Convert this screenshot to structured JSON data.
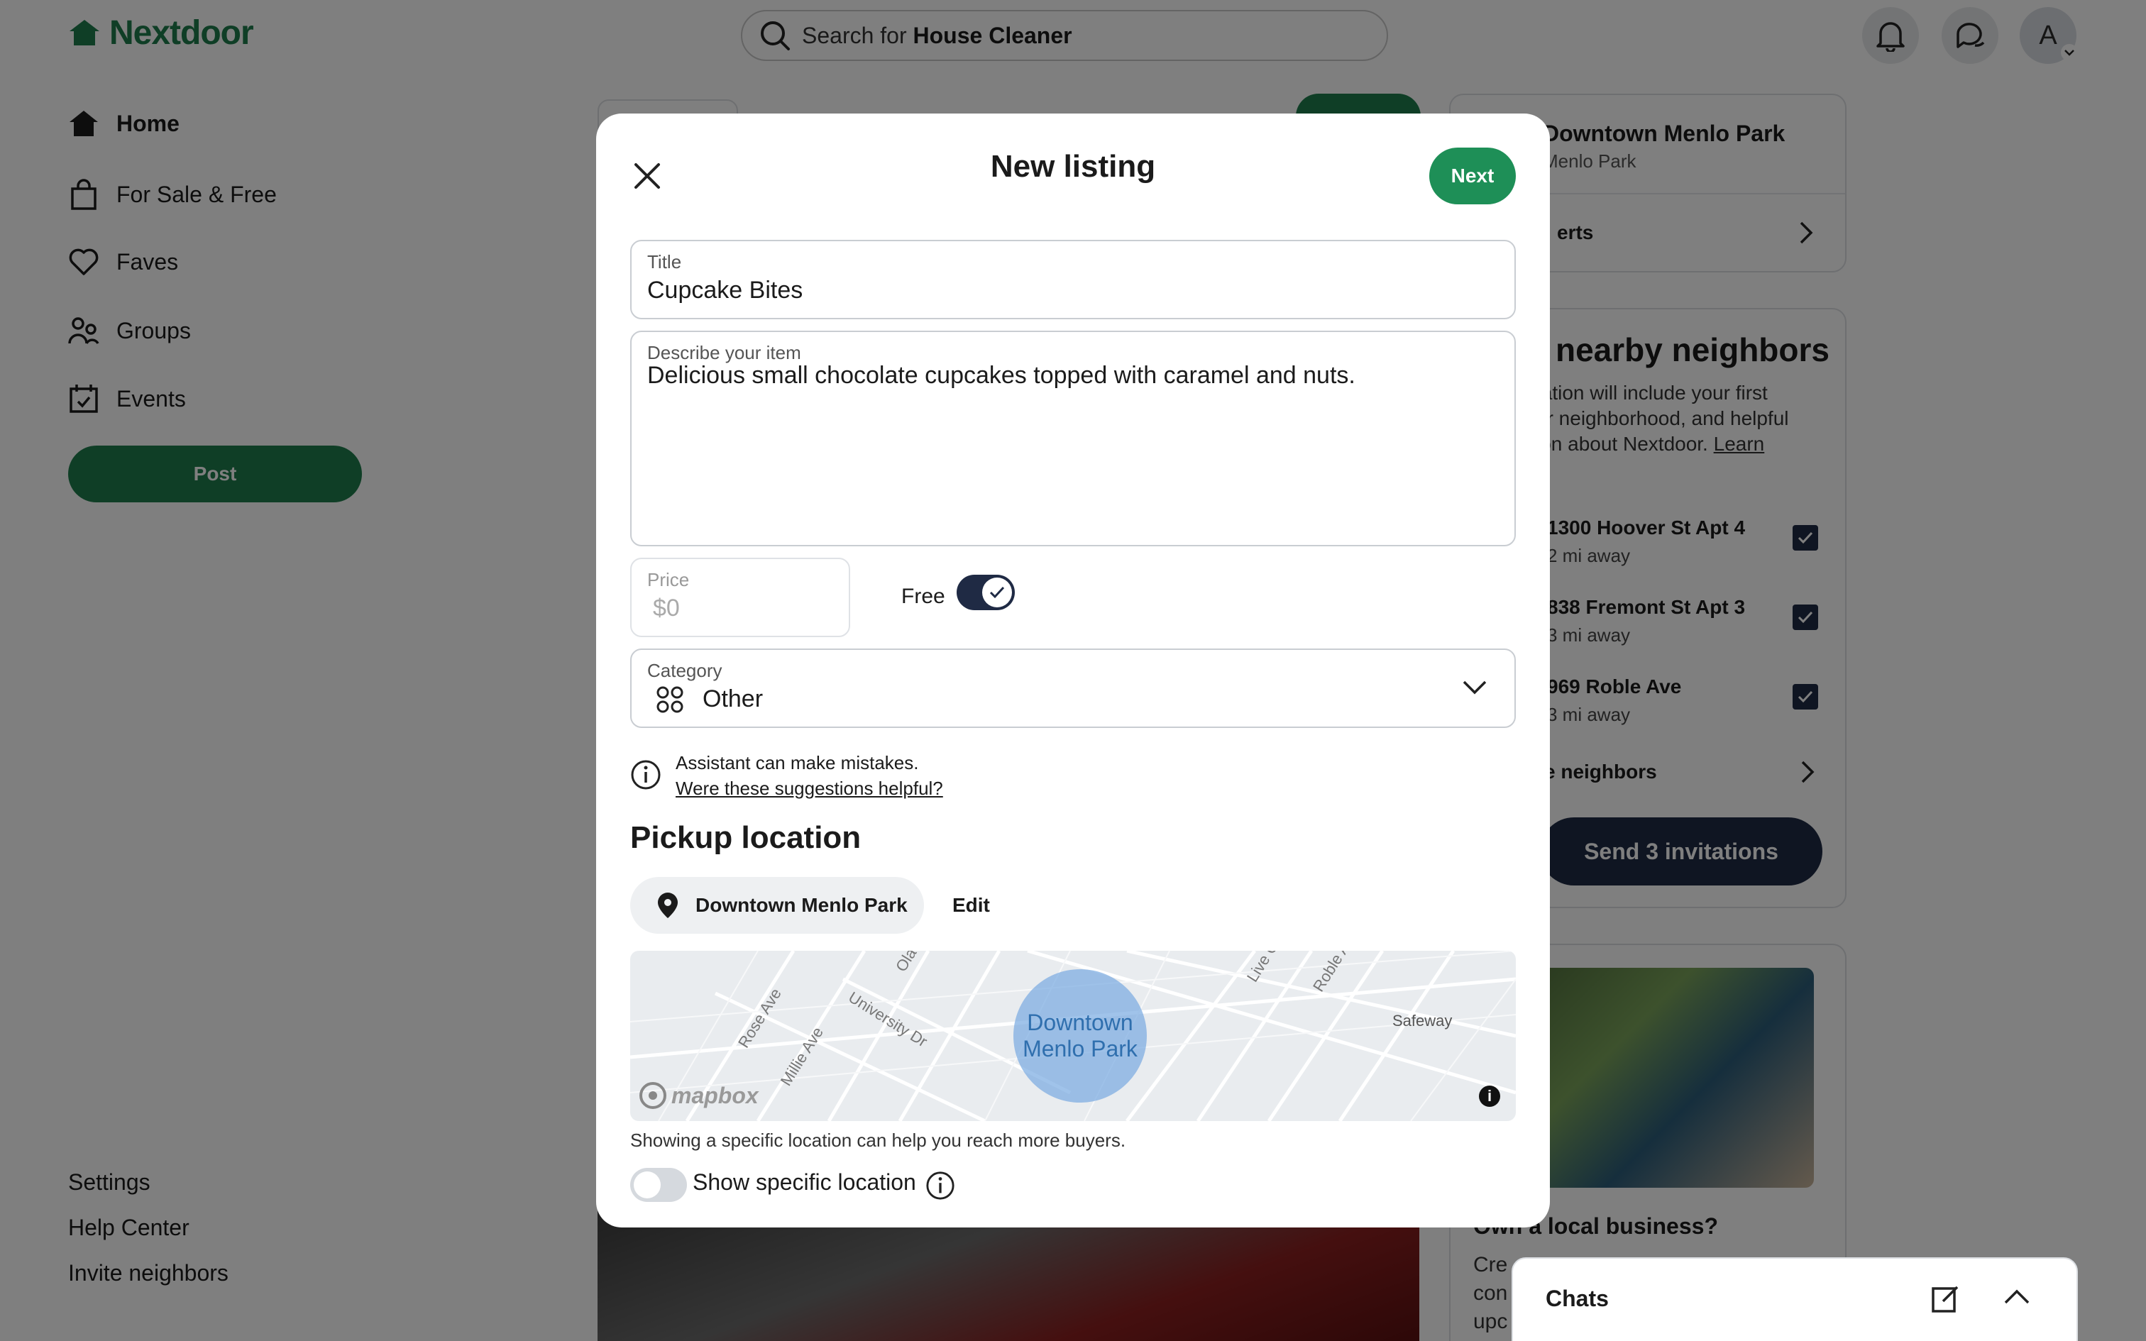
{
  "app": {
    "name": "Nextdoor"
  },
  "header": {
    "search_prefix": "Search for",
    "search_term": "House Cleaner",
    "avatar_initial": "A"
  },
  "sidebar": {
    "items": [
      {
        "label": "Home",
        "icon": "home-icon"
      },
      {
        "label": "For Sale & Free",
        "icon": "shopping-bag-icon"
      },
      {
        "label": "Faves",
        "icon": "heart-icon"
      },
      {
        "label": "Groups",
        "icon": "groups-icon"
      },
      {
        "label": "Events",
        "icon": "calendar-icon"
      }
    ],
    "post_label": "Post",
    "footer": [
      "Settings",
      "Help Center",
      "Invite neighbors"
    ]
  },
  "right": {
    "neighborhood": {
      "name": "Downtown Menlo Park",
      "city": "Menlo Park",
      "alerts_fragment": "erts"
    },
    "invite": {
      "title_fragment": "nearby neighbors",
      "body_fragment_1": "tation will include your first",
      "body_fragment_2": "ur neighborhood, and helpful",
      "body_fragment_3": "ion about Nextdoor.",
      "learn": "Learn",
      "rows": [
        {
          "address": "1300 Hoover St Apt 4",
          "distance": "2 mi away"
        },
        {
          "address": "838 Fremont St Apt 3",
          "distance": "3 mi away"
        },
        {
          "address": "969 Roble Ave",
          "distance": "3 mi away"
        }
      ],
      "more_fragment": "e neighbors",
      "send_label": "Send 3 invitations"
    },
    "business": {
      "title_fragment": "Own a local business?",
      "body_fragments": [
        "Cre",
        "con",
        "upc"
      ]
    },
    "chats_label": "Chats"
  },
  "modal": {
    "title": "New listing",
    "next_label": "Next",
    "title_field": {
      "label": "Title",
      "value": "Cupcake Bites"
    },
    "description_field": {
      "label": "Describe your item",
      "value": "Delicious small chocolate cupcakes topped with caramel and nuts."
    },
    "price_field": {
      "label": "Price",
      "placeholder": "$0"
    },
    "free_label": "Free",
    "free_on": true,
    "category_field": {
      "label": "Category",
      "value": "Other"
    },
    "assistant_note": "Assistant can make mistakes.",
    "assistant_link": "Were these suggestions helpful?",
    "pickup_heading": "Pickup location",
    "pickup_place": "Downtown Menlo Park",
    "edit_label": "Edit",
    "map": {
      "area_label_1": "Downtown",
      "area_label_2": "Menlo Park",
      "streets": [
        "Rose Ave",
        "Millie Ave",
        "University Dr",
        "Live O",
        "Roble A",
        "Ola"
      ],
      "poi": "Safeway",
      "attribution": "mapbox"
    },
    "helper_text": "Showing a specific location can help you reach more buyers.",
    "specific_location_label": "Show specific location",
    "specific_location_on": false
  },
  "colors": {
    "brand": "#1e7d4c",
    "dark": "#1f2a44",
    "next": "#1e8f57"
  }
}
